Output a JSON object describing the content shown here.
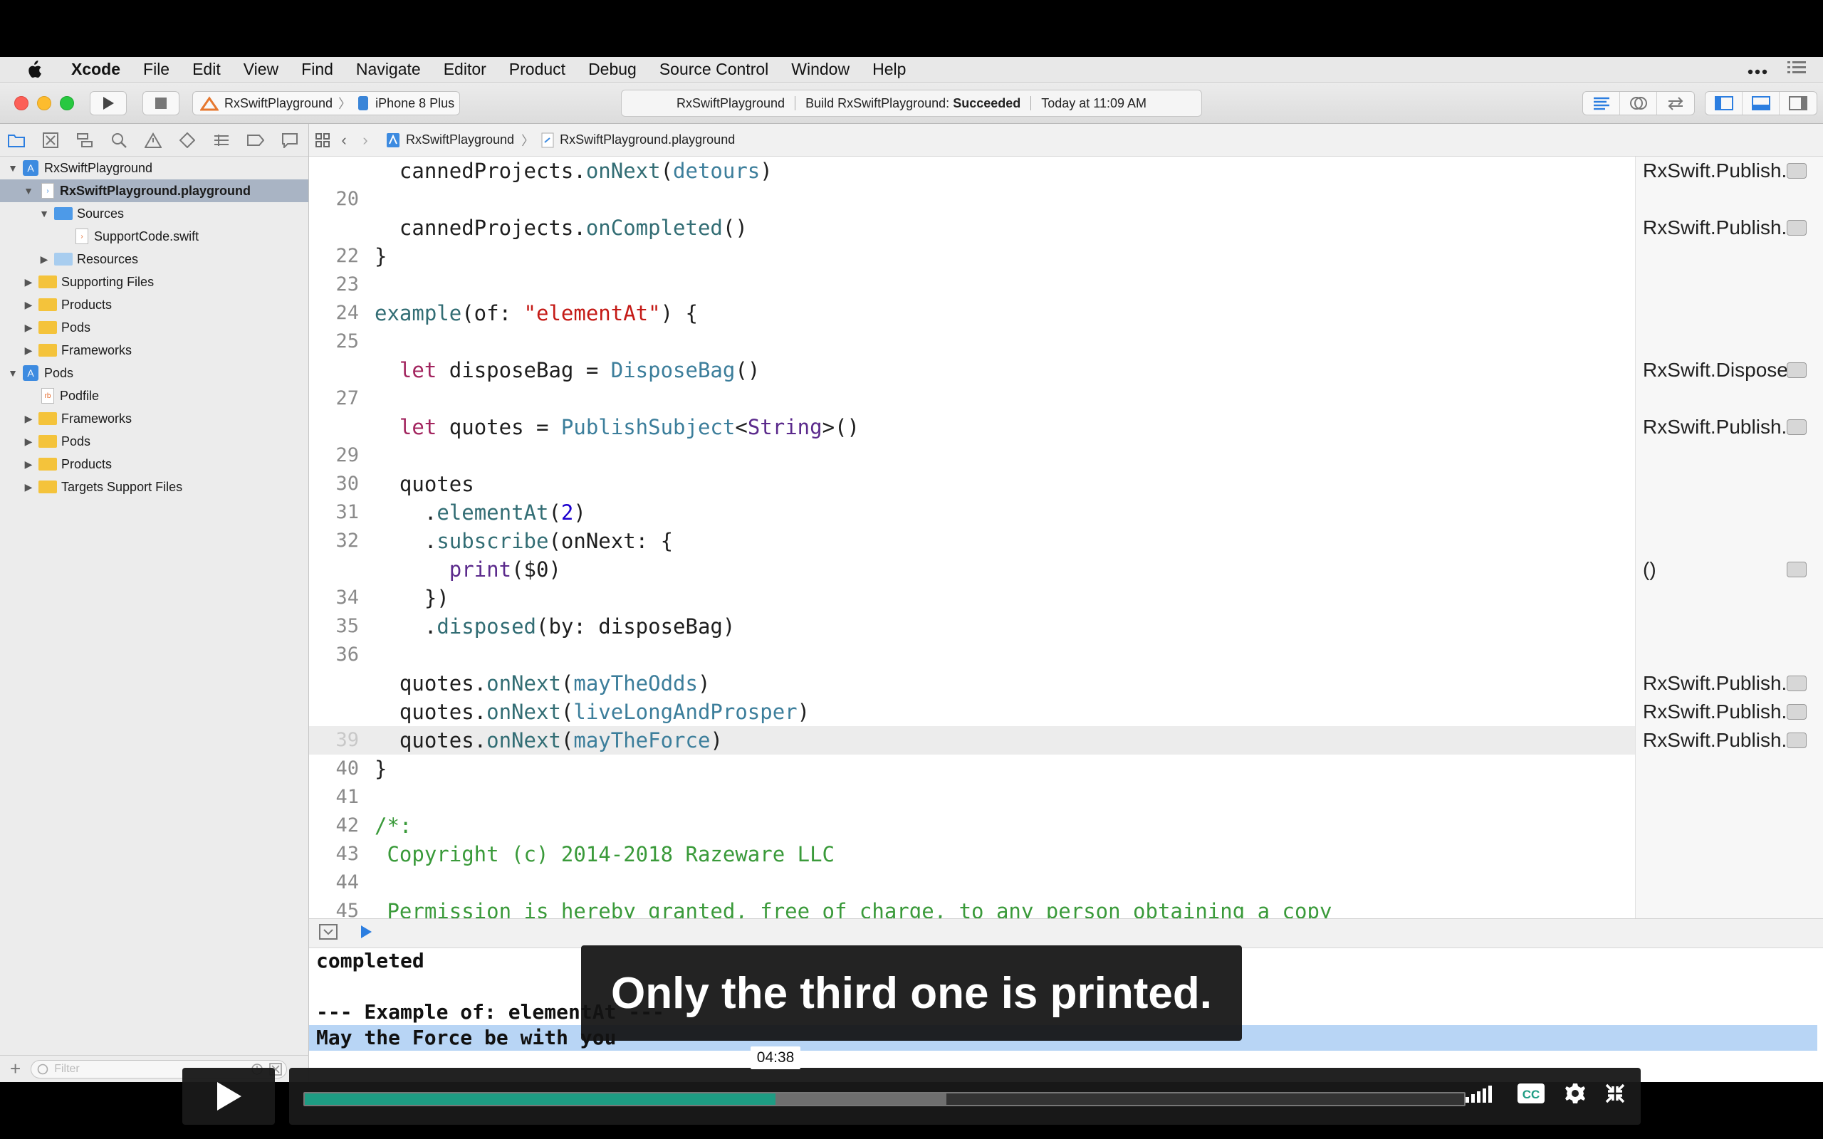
{
  "menubar": {
    "items": [
      "Xcode",
      "File",
      "Edit",
      "View",
      "Find",
      "Navigate",
      "Editor",
      "Product",
      "Debug",
      "Source Control",
      "Window",
      "Help"
    ]
  },
  "toolbar": {
    "scheme": "RxSwiftPlayground",
    "device": "iPhone 8 Plus",
    "activity_project": "RxSwiftPlayground",
    "activity_build_prefix": "Build RxSwiftPlayground:",
    "activity_build_status": "Succeeded",
    "activity_time": "Today at 11:09 AM"
  },
  "navigator": {
    "tree": [
      {
        "label": "RxSwiftPlayground",
        "icon": "project-icon",
        "depth": 0,
        "expanded": true
      },
      {
        "label": "RxSwiftPlayground.playground",
        "icon": "playground-file-icon",
        "depth": 1,
        "expanded": true,
        "selected": true
      },
      {
        "label": "Sources",
        "icon": "folder-blue-icon",
        "depth": 2,
        "expanded": true
      },
      {
        "label": "SupportCode.swift",
        "icon": "swift-file-icon",
        "depth": 3
      },
      {
        "label": "Resources",
        "icon": "folder-lightblue-icon",
        "depth": 2,
        "expanded": false
      },
      {
        "label": "Supporting Files",
        "icon": "folder-icon",
        "depth": 1,
        "expanded": false
      },
      {
        "label": "Products",
        "icon": "folder-icon",
        "depth": 1,
        "expanded": false
      },
      {
        "label": "Pods",
        "icon": "folder-icon",
        "depth": 1,
        "expanded": false
      },
      {
        "label": "Frameworks",
        "icon": "folder-icon",
        "depth": 1,
        "expanded": false
      },
      {
        "label": "Pods",
        "icon": "project-icon",
        "depth": 0,
        "expanded": true
      },
      {
        "label": "Podfile",
        "icon": "ruby-file-icon",
        "depth": 1
      },
      {
        "label": "Frameworks",
        "icon": "folder-icon",
        "depth": 1,
        "expanded": false
      },
      {
        "label": "Pods",
        "icon": "folder-icon",
        "depth": 1,
        "expanded": false
      },
      {
        "label": "Products",
        "icon": "folder-icon",
        "depth": 1,
        "expanded": false
      },
      {
        "label": "Targets Support Files",
        "icon": "folder-icon",
        "depth": 1,
        "expanded": false
      }
    ],
    "filter_placeholder": "Filter"
  },
  "jumpbar": {
    "project": "RxSwiftPlayground",
    "file": "RxSwiftPlayground.playground"
  },
  "editor": {
    "lines": [
      {
        "num": "",
        "tokens": [
          [
            "",
            "  cannedProjects."
          ],
          [
            "f",
            "onNext"
          ],
          [
            "",
            "("
          ],
          [
            "t",
            "detours"
          ],
          [
            "",
            ")"
          ]
        ]
      },
      {
        "num": "20",
        "tokens": []
      },
      {
        "num": "",
        "tokens": [
          [
            "",
            "  cannedProjects."
          ],
          [
            "f",
            "onCompleted"
          ],
          [
            "",
            "()"
          ]
        ]
      },
      {
        "num": "22",
        "tokens": [
          [
            "",
            "}"
          ]
        ]
      },
      {
        "num": "23",
        "tokens": []
      },
      {
        "num": "24",
        "tokens": [
          [
            "f",
            "example"
          ],
          [
            "",
            "(of: "
          ],
          [
            "s",
            "\"elementAt\""
          ],
          [
            "",
            ") {"
          ]
        ]
      },
      {
        "num": "25",
        "tokens": []
      },
      {
        "num": "",
        "tokens": [
          [
            "k",
            "  let"
          ],
          [
            "",
            " disposeBag = "
          ],
          [
            "t",
            "DisposeBag"
          ],
          [
            "",
            "()"
          ]
        ]
      },
      {
        "num": "27",
        "tokens": []
      },
      {
        "num": "",
        "tokens": [
          [
            "k",
            "  let"
          ],
          [
            "",
            " quotes = "
          ],
          [
            "t",
            "PublishSubject"
          ],
          [
            "",
            "<"
          ],
          [
            "p",
            "String"
          ],
          [
            "",
            ">()"
          ]
        ]
      },
      {
        "num": "29",
        "tokens": []
      },
      {
        "num": "30",
        "tokens": [
          [
            "",
            "  quotes"
          ]
        ]
      },
      {
        "num": "31",
        "tokens": [
          [
            "",
            "    ."
          ],
          [
            "f",
            "elementAt"
          ],
          [
            "",
            "("
          ],
          [
            "n",
            "2"
          ],
          [
            "",
            ")"
          ]
        ]
      },
      {
        "num": "32",
        "tokens": [
          [
            "",
            "    ."
          ],
          [
            "f",
            "subscribe"
          ],
          [
            "",
            "(onNext: {"
          ]
        ]
      },
      {
        "num": "",
        "tokens": [
          [
            "p",
            "      print"
          ],
          [
            "",
            "($0)"
          ]
        ]
      },
      {
        "num": "34",
        "tokens": [
          [
            "",
            "    })"
          ]
        ]
      },
      {
        "num": "35",
        "tokens": [
          [
            "",
            "    ."
          ],
          [
            "f",
            "disposed"
          ],
          [
            "",
            "(by: disposeBag)"
          ]
        ]
      },
      {
        "num": "36",
        "tokens": []
      },
      {
        "num": "",
        "tokens": [
          [
            "",
            "  quotes."
          ],
          [
            "f",
            "onNext"
          ],
          [
            "",
            "("
          ],
          [
            "t",
            "mayTheOdds"
          ],
          [
            "",
            ")"
          ]
        ]
      },
      {
        "num": "",
        "tokens": [
          [
            "",
            "  quotes."
          ],
          [
            "f",
            "onNext"
          ],
          [
            "",
            "("
          ],
          [
            "t",
            "liveLongAndProsper"
          ],
          [
            "",
            ")"
          ]
        ]
      },
      {
        "num": "39",
        "current": true,
        "tokens": [
          [
            "",
            "  quotes."
          ],
          [
            "f",
            "onNext"
          ],
          [
            "",
            "("
          ],
          [
            "t",
            "mayTheForce"
          ],
          [
            "",
            ")"
          ]
        ]
      },
      {
        "num": "40",
        "tokens": [
          [
            "",
            "}"
          ]
        ]
      },
      {
        "num": "41",
        "tokens": []
      },
      {
        "num": "42",
        "tokens": [
          [
            "c",
            "/*:"
          ]
        ]
      },
      {
        "num": "43",
        "tokens": [
          [
            "c",
            " Copyright (c) 2014-2018 Razeware LLC"
          ]
        ]
      },
      {
        "num": "44",
        "tokens": []
      },
      {
        "num": "45",
        "tokens": [
          [
            "c",
            " Permission is hereby granted, free of charge, to any person obtaining a copy"
          ]
        ]
      }
    ]
  },
  "results": [
    {
      "line": 0,
      "text": "RxSwift.Publish..."
    },
    {
      "line": 2,
      "text": "RxSwift.Publish..."
    },
    {
      "line": 7,
      "text": "RxSwift.Dispose..."
    },
    {
      "line": 9,
      "text": "RxSwift.Publish..."
    },
    {
      "line": 14,
      "text": "()"
    },
    {
      "line": 18,
      "text": "RxSwift.Publish..."
    },
    {
      "line": 19,
      "text": "RxSwift.Publish..."
    },
    {
      "line": 20,
      "text": "RxSwift.Publish..."
    }
  ],
  "console": {
    "lines": [
      "completed",
      "",
      "--- Example of: elementAt ---",
      "May the Force be with you"
    ]
  },
  "caption": "Only the third one is printed.",
  "player": {
    "current_time": "04:38",
    "played_fraction": 0.4063,
    "buffered_fraction": 0.5536
  },
  "colors": {
    "accent": "#1e9c83",
    "selection": "#b8d5f5"
  }
}
